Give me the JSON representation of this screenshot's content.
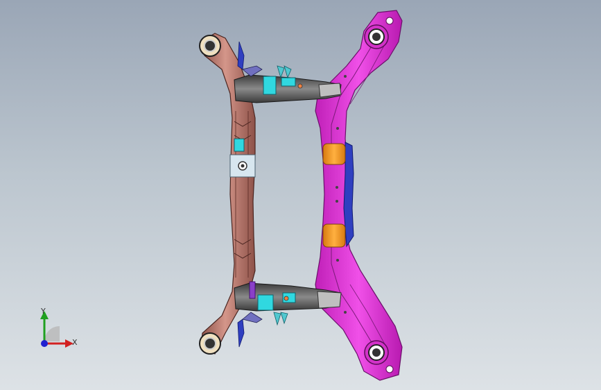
{
  "viewport": {
    "background_top": "#9aa6b6",
    "background_bottom": "#dde2e6"
  },
  "model": {
    "parts": [
      {
        "name": "rear-crossmember",
        "color": "#b87a6e"
      },
      {
        "name": "main-subframe",
        "color": "#e535d6"
      },
      {
        "name": "control-arm-upper",
        "color": "#5a5a5a"
      },
      {
        "name": "control-arm-lower",
        "color": "#5a5a5a"
      },
      {
        "name": "bushing",
        "color": "#f0a020"
      },
      {
        "name": "bracket",
        "color": "#30d8e0"
      },
      {
        "name": "brace",
        "color": "#3040c8"
      },
      {
        "name": "clamp",
        "color": "#d7e6ef"
      }
    ]
  },
  "triad": {
    "x_label": "X",
    "y_label": "Y",
    "x_color": "#d22020",
    "y_color": "#20a020",
    "z_color": "#2020d0"
  }
}
